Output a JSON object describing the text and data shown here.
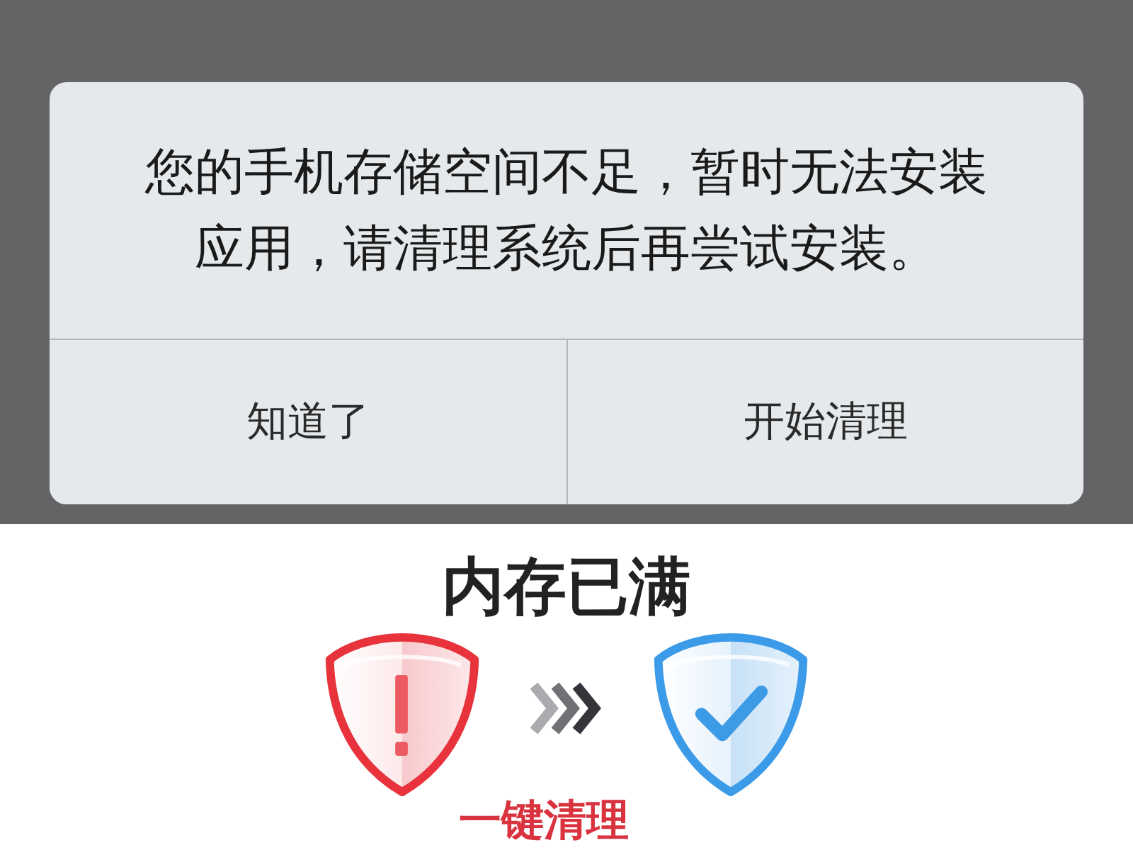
{
  "dialog": {
    "message": "您的手机存储空间不足，暂时无法安装应用，请清理系统后再尝试安装。",
    "buttons": [
      {
        "label": "知道了"
      },
      {
        "label": "开始清理"
      }
    ]
  },
  "banner": {
    "title": "内存已满",
    "action": "一键清理"
  }
}
